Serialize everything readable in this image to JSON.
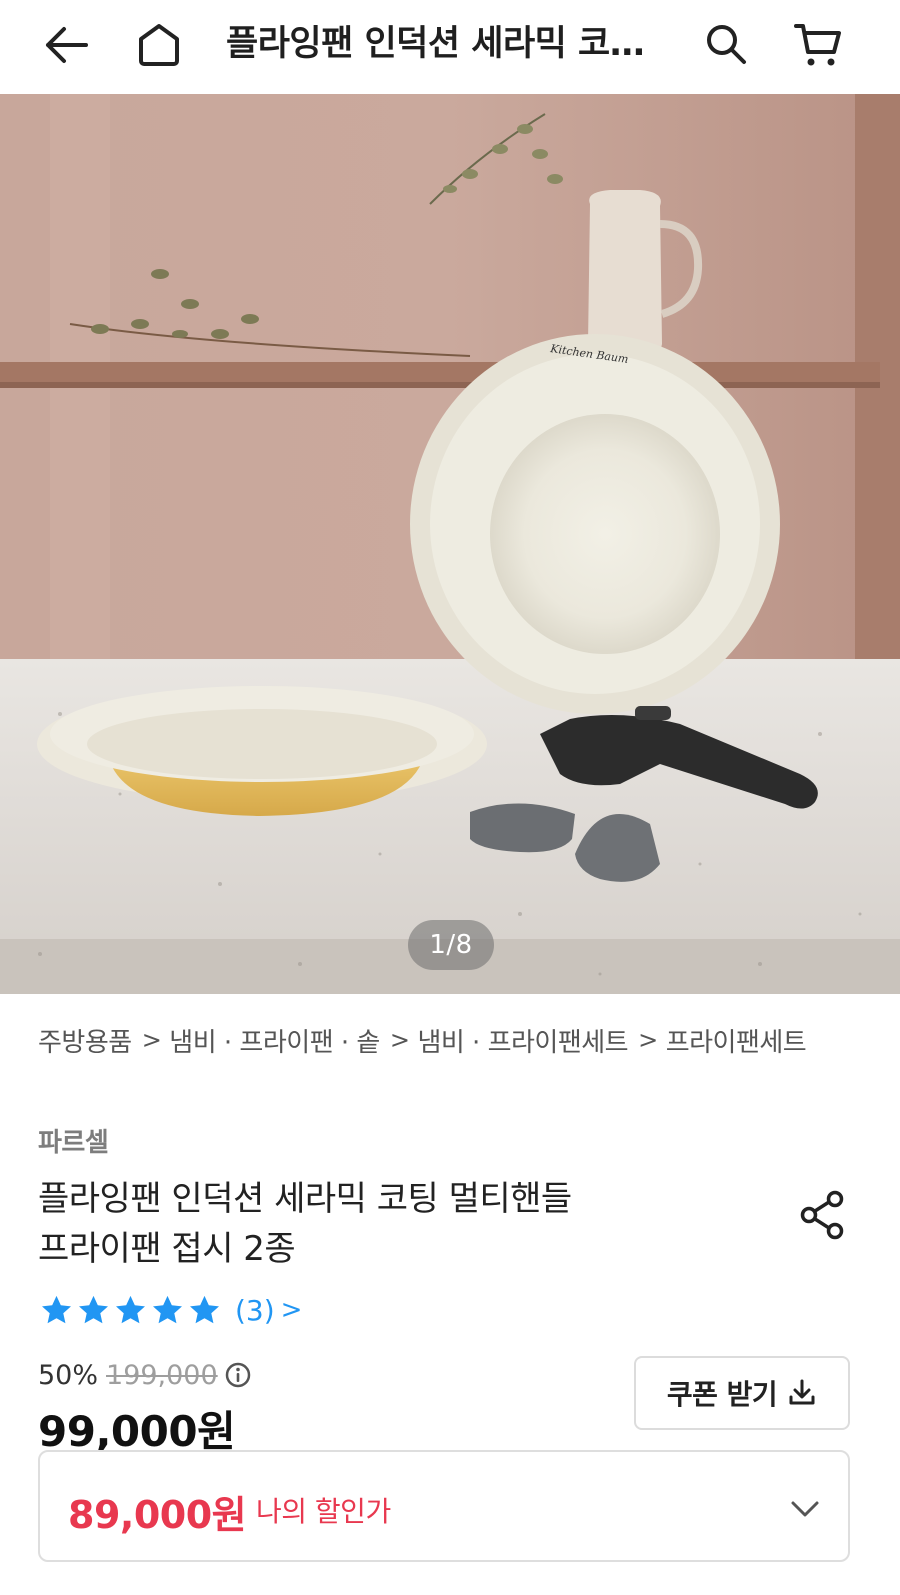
{
  "header": {
    "title": "플라잉팬 인덕션 세라믹 코…",
    "icons": [
      "back-arrow-icon",
      "home-icon",
      "search-icon",
      "cart-icon"
    ]
  },
  "gallery": {
    "image_description_icon": "product-photo",
    "counter": "1/8",
    "brand_on_pan": "Kitchen Baum"
  },
  "breadcrumb": {
    "items": [
      "주방용품",
      "냄비 · 프라이팬 · 솥",
      "냄비 · 프라이팬세트",
      "프라이팬세트"
    ],
    "separator": ">"
  },
  "product": {
    "seller": "파르셀",
    "title_line1": "플라잉팬 인덕션 세라믹 코팅 멀티핸들",
    "title_line2": "프라이팬 접시 2종",
    "rating_stars": 5,
    "review_count": "(3)",
    "review_arrow": ">",
    "discount_rate": "50%",
    "original_price": "199,000",
    "sale_price": "99,000원",
    "coupon_label": "쿠폰 받기",
    "my_price": "89,000원",
    "my_price_label": "나의 할인가"
  },
  "colors": {
    "accent_red": "#e8384f",
    "star_blue": "#2196f3",
    "text_dark": "#1f1f1f",
    "text_gray": "#7d7d7d"
  }
}
